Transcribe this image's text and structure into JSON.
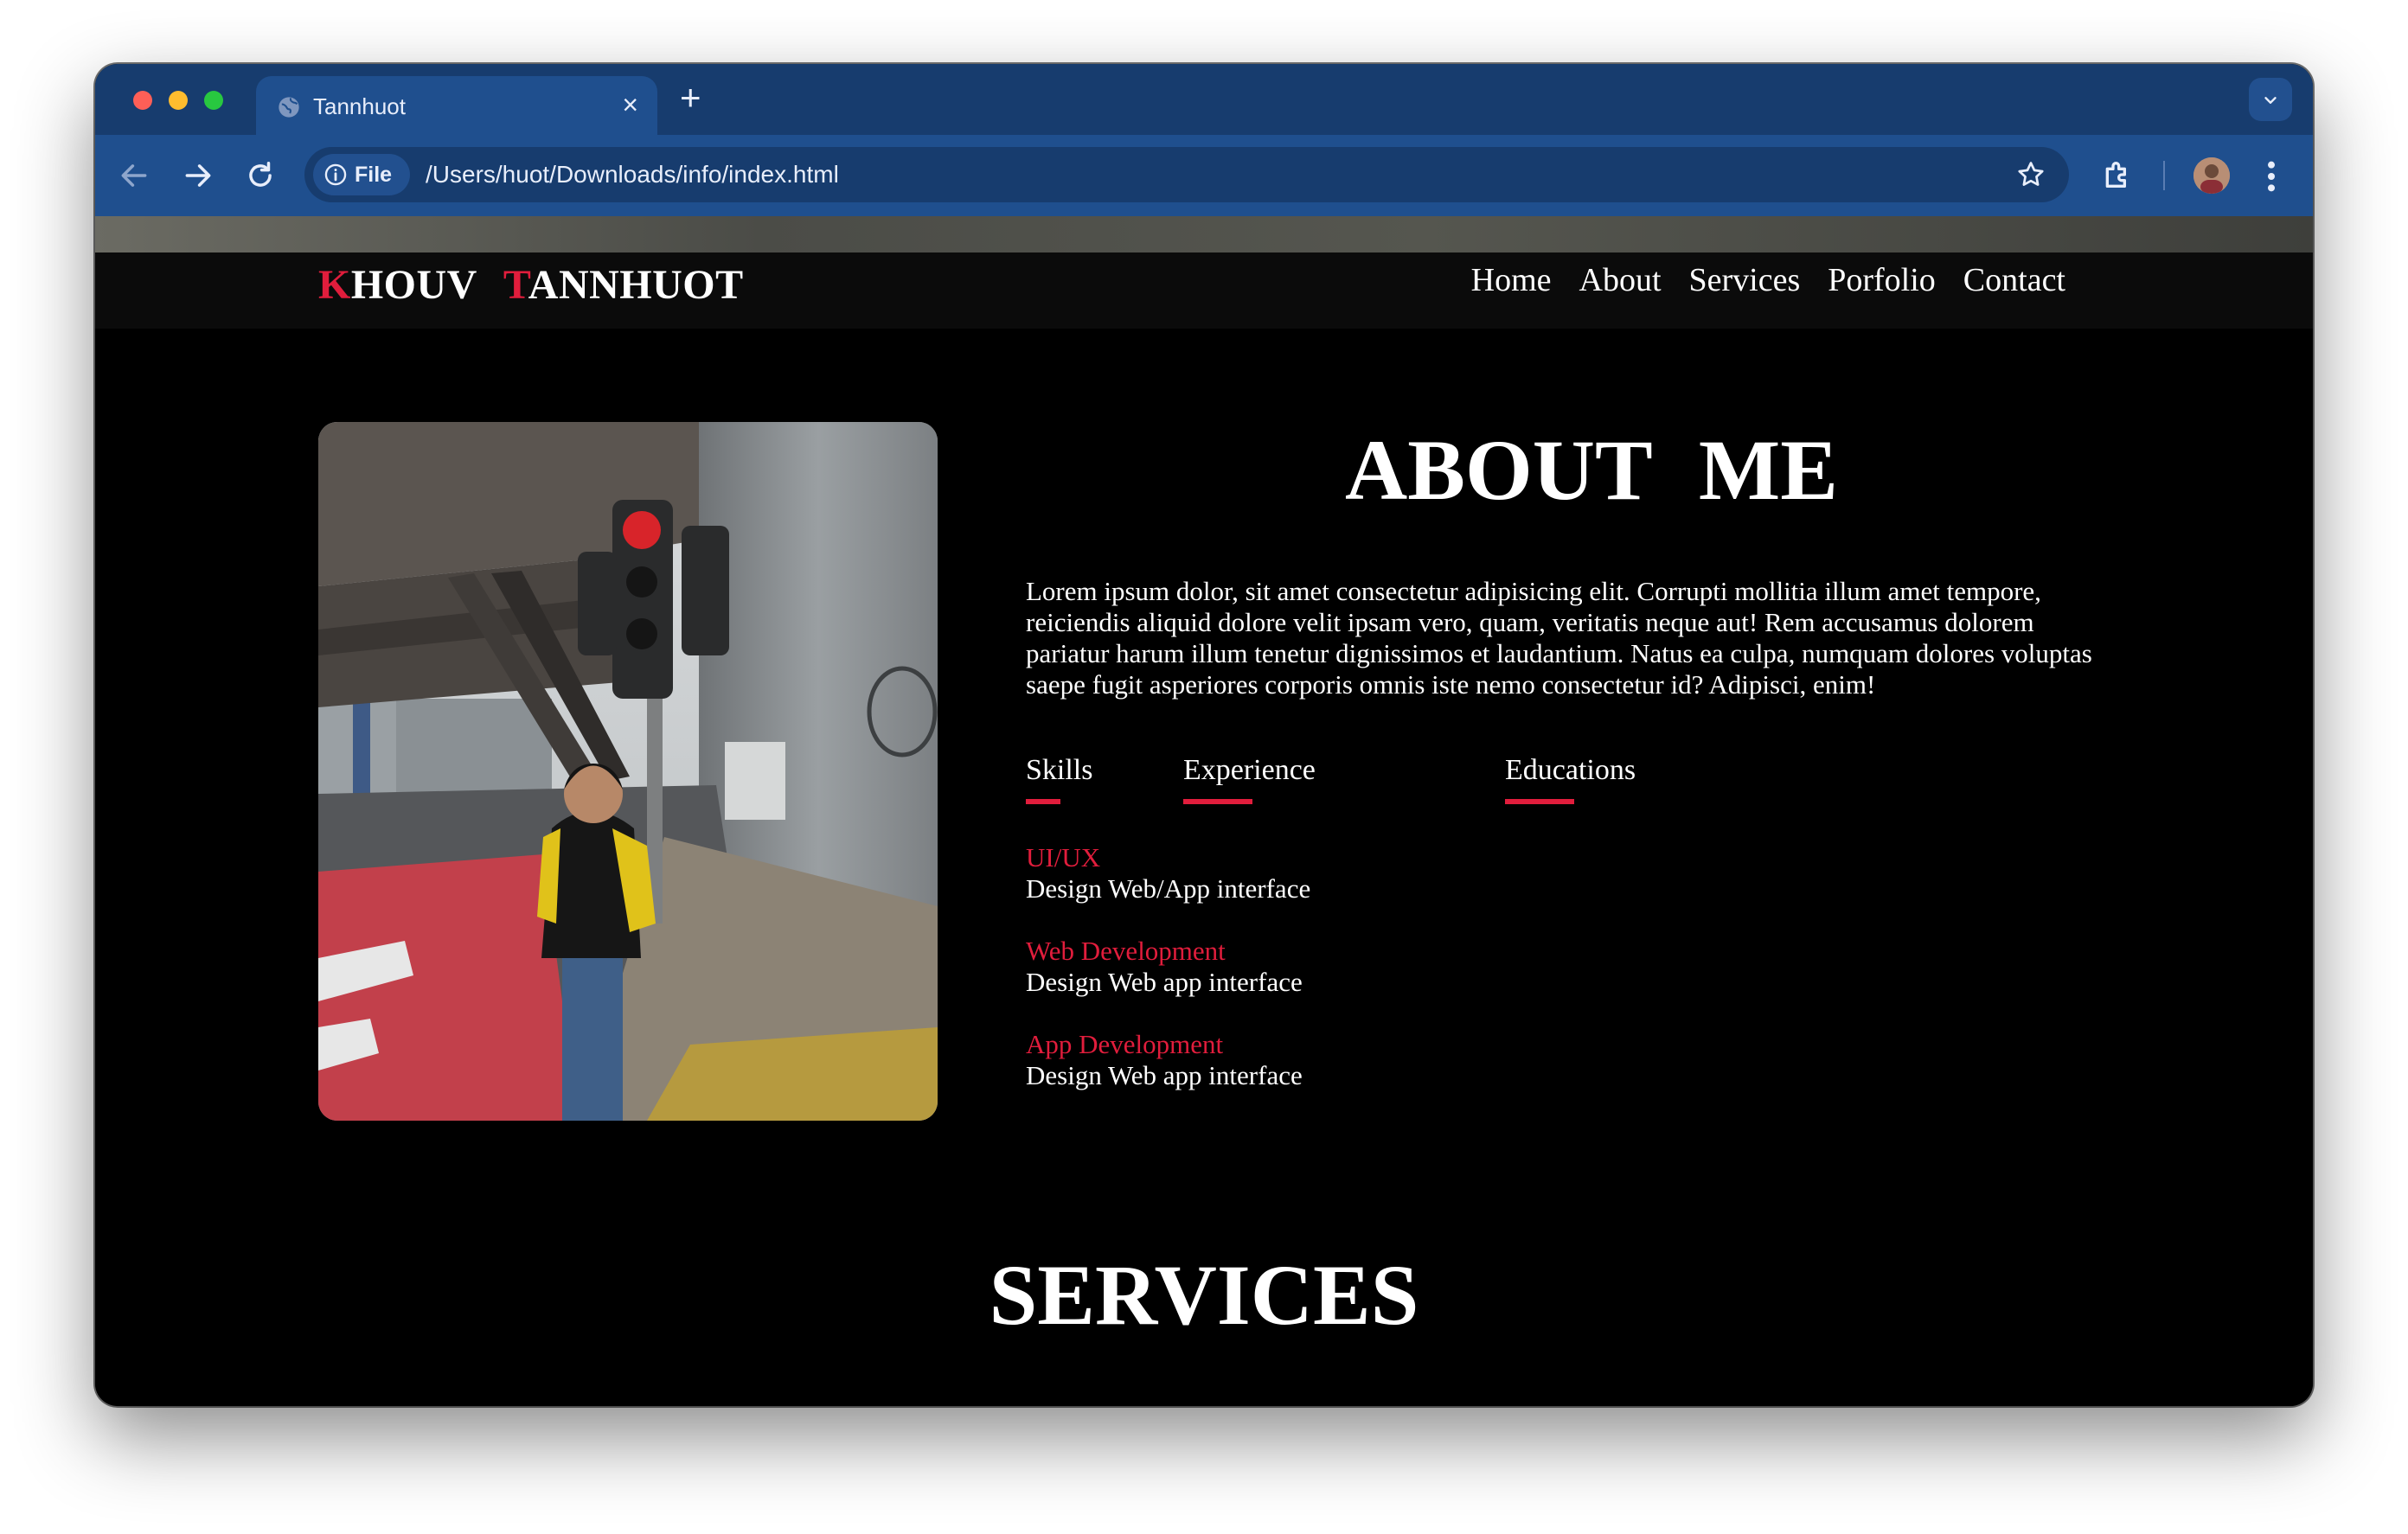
{
  "browser": {
    "tab_title": "Tannhuot",
    "tab_close": "×",
    "new_tab": "+",
    "site_chip": "File",
    "url": "/Users/huot/Downloads/info/index.html"
  },
  "site": {
    "logo": {
      "first_initial": "K",
      "first_rest": "HOUV",
      "last_initial": "T",
      "last_rest": "ANNHUOT"
    },
    "nav": [
      "Home",
      "About",
      "Services",
      "Porfolio",
      "Contact"
    ]
  },
  "about": {
    "title": "ABOUT ME",
    "text": "Lorem ipsum dolor, sit amet consectetur adipisicing elit. Corrupti mollitia illum amet tempore, reiciendis aliquid dolore velit ipsam vero, quam, veritatis neque aut! Rem accusamus dolorem pariatur harum illum tenetur dignissimos et laudantium. Natus ea culpa, numquam dolores voluptas saepe fugit asperiores corporis omnis iste nemo consectetur id? Adipisci, enim!",
    "tabs": [
      "Skills",
      "Experience",
      "Educations"
    ],
    "skills": [
      {
        "name": "UI/UX",
        "desc": "Design Web/App interface"
      },
      {
        "name": "Web Development",
        "desc": "Design Web app interface"
      },
      {
        "name": "App Development",
        "desc": "Design Web app interface"
      }
    ]
  },
  "services": {
    "title": "SERVICES"
  },
  "colors": {
    "accent": "#e11d3c",
    "page_bg": "#000000",
    "chrome_tabstrip": "#173c6e",
    "chrome_toolbar": "#1f4f8e"
  }
}
